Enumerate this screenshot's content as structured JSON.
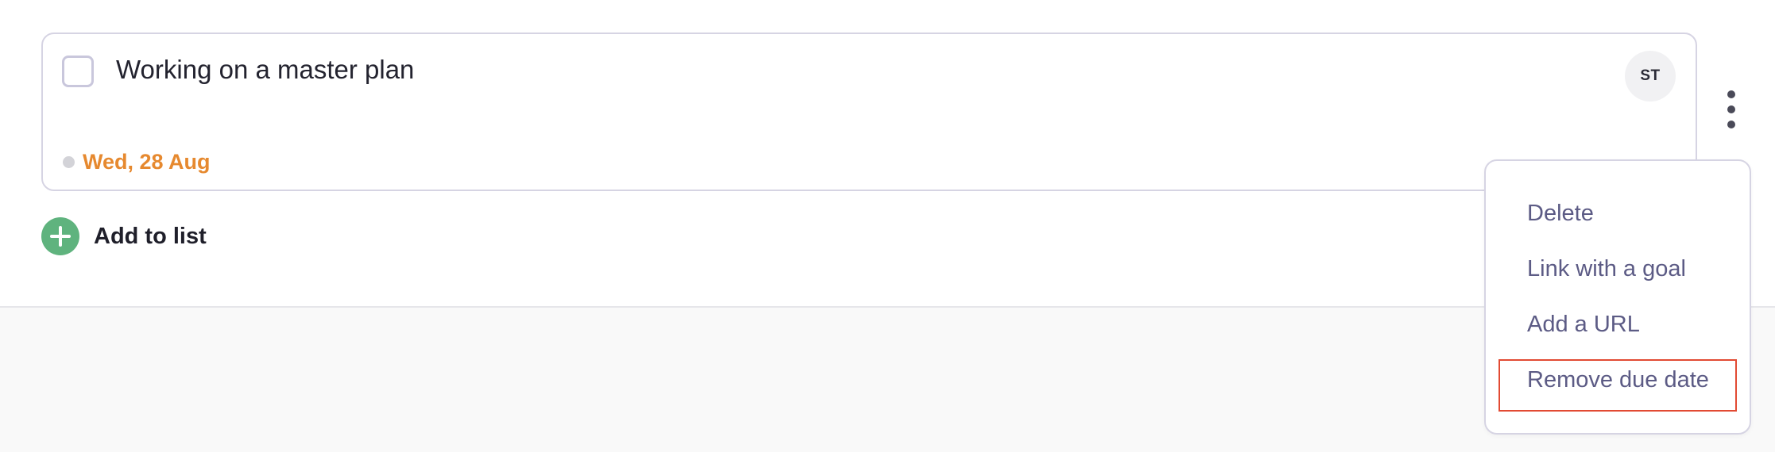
{
  "task": {
    "title": "Working on a master plan",
    "assignee_initials": "ST",
    "due_date": "Wed, 28 Aug",
    "checkbox_checked": false
  },
  "add_to_list": {
    "label": "Add to list"
  },
  "context_menu": {
    "items": [
      {
        "label": "Delete"
      },
      {
        "label": "Link with a goal"
      },
      {
        "label": "Add a URL"
      },
      {
        "label": "Remove due date"
      }
    ]
  },
  "colors": {
    "due_date": "#e6892f",
    "add_button": "#5fb37e",
    "menu_text": "#5c5b85",
    "highlight_outline": "#e24a33",
    "card_border": "#d6d4e3"
  },
  "icons": {
    "checkbox": "checkbox-icon",
    "avatar": "avatar",
    "kebab": "more-vertical-icon",
    "add": "plus-circle-icon",
    "due_dot": "dot-icon"
  }
}
